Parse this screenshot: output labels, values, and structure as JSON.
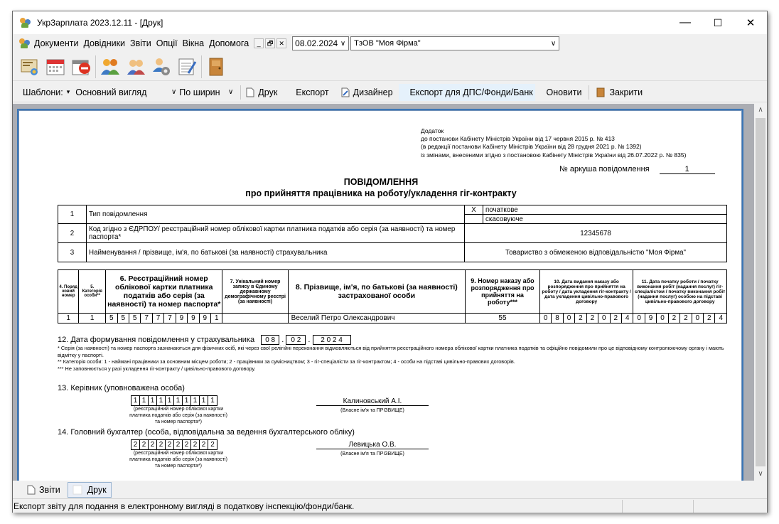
{
  "window": {
    "title": "УкрЗарплата 2023.12.11 - [Друк]",
    "min": "—",
    "max": "☐",
    "close": "✕"
  },
  "menu": {
    "items": [
      "Документи",
      "Довідники",
      "Звіти",
      "Опції",
      "Вікна",
      "Допомога"
    ],
    "mdi_min": "_",
    "mdi_restore": "🗗",
    "mdi_close": "✕",
    "date": "08.02.2024",
    "org": "ТзОВ \"Моя Фірма\""
  },
  "toolbar2": {
    "templates_label": "Шаблони:",
    "view": "Основний вигляд",
    "fit": "По ширин",
    "print": "Друк",
    "export": "Експорт",
    "designer": "Дизайнер",
    "export_tax": "Експорт для ДПС/Фонди/Банк",
    "refresh": "Оновити",
    "close": "Закрити"
  },
  "doc": {
    "annex": [
      "Додаток",
      "до постанови Кабінету Міністрів України від 17 червня 2015 р. № 413",
      "(в редакції постанови Кабінету Міністрів України від 28 грудня 2021 р. № 1392)",
      "із змінами, внесеними згідно з постановою Кабінету Міністрів України від 26.07.2022 р. № 835)"
    ],
    "sheet_label": "№ аркуша повідомлення",
    "sheet_no": "1",
    "title": "ПОВІДОМЛЕННЯ",
    "subtitle": "про прийняття працівника на роботу/укладення гіг-контракту",
    "t1": {
      "r1_no": "1",
      "r1_label": "Тип повідомлення",
      "x": "X",
      "opt1": "початкове",
      "opt2": "скасовуюче",
      "r2_no": "2",
      "r2_label": "Код згідно з ЄДРПОУ/ реєстраційний номер облікової картки платника податків або серія (за наявності) та номер паспорта*",
      "r2_value": "12345678",
      "r3_no": "3",
      "r3_label": "Найменування / прізвище, ім'я, по батькові (за наявності) страхувальника",
      "r3_value": "Товариство з обмеженою відповідальністю \"Моя Фірма\""
    },
    "t2": {
      "h4": "4. Поряд ковий номер",
      "h5": "5. Категорія особи**",
      "h6": "6. Реєстраційний номер облікової картки платника податків або серія (за наявності) та номер паспорта*",
      "h7": "7. Унікальний номер запису в Єдиному державному демографічному реєстрі (за наявності)",
      "h8": "8. Прізвище, ім'я, по батькові (за наявності) застрахованої особи",
      "h9": "9. Номер наказу або розпорядження про прийняття на роботу***",
      "h10": "10. Дата видання наказу або розпорядження про прийняття на роботу / дата укладення гіг-контракту / дата укладення цивільно-правового договору",
      "h11": "11. Дата початку роботи / початку виконання робіт (надання послуг) гіг-спеціалістом / початку виконання робіт (надання послуг) особою на підставі цивільно-правового договору",
      "no": "1",
      "cat": "1",
      "tax": [
        "5",
        "5",
        "5",
        "7",
        "7",
        "7",
        "9",
        "9",
        "9",
        "1"
      ],
      "name": "Веселий Петро Олександрович",
      "order": "55",
      "d10": [
        "0",
        "8",
        "0",
        "2",
        "2",
        "0",
        "2",
        "4"
      ],
      "d11": [
        "0",
        "9",
        "0",
        "2",
        "2",
        "0",
        "2",
        "4"
      ]
    },
    "s12": {
      "label": "12. Дата формування повідомлення у страхувальника",
      "dd": "0 8",
      "mm": "0 2",
      "yyyy": "2 0 2 4",
      "dot": "."
    },
    "foot": [
      "* Серія (за наявності) та номер паспорта зазначаються для фізичних осіб, які через свої релігійні переконання відмовляються від прийняття реєстраційного номера облікової картки платника податків та офіційно повідомили про це відповідному контролюючому органу і мають відмітку у паспорті.",
      "** Категорія особи: 1 - наймані працівники за основним місцем роботи; 2 - працівники за сумісництвом; 3 - гіг-спеціалісти за гіг-контрактом; 4 - особи на підставі цивільно-правових договорів.",
      "*** Не заповнюється у разі укладення гіг-контракту / цивільно-правового договору."
    ],
    "s13": {
      "label": "13. Керівник (уповноважена особа)",
      "digits": [
        "1",
        "1",
        "1",
        "1",
        "1",
        "1",
        "1",
        "1",
        "1",
        "1"
      ],
      "cap": "(реєстраційний номер облікової картки платника податків або серія (за наявності) та номер паспорта*)",
      "sig": "Калиновський А.І.",
      "sig_cap": "(Власне ім'я та ПРІЗВИЩЕ)"
    },
    "s14": {
      "label": "14. Головний бухгалтер (особа, відповідальна за ведення бухгалтерського обліку)",
      "digits": [
        "2",
        "2",
        "2",
        "2",
        "2",
        "2",
        "2",
        "2",
        "2",
        "2"
      ],
      "cap": "(реєстраційний номер облікової картки платника податків або серія (за наявності) та номер паспорта*)",
      "sig": "Левицька О.В.",
      "sig_cap": "(Власне ім'я та ПРІЗВИЩЕ)"
    }
  },
  "tabs": {
    "reports": "Звіти",
    "print": "Друк"
  },
  "status": "Експорт звіту для подання в електронному вигляді в податкову інспекцію/фонди/банк.",
  "colors": {
    "accent": "#3b76b6",
    "viewport": "#abadb3"
  }
}
